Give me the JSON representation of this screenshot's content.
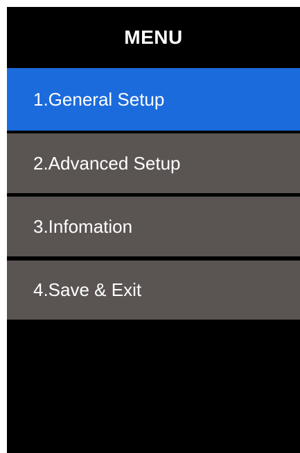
{
  "menu": {
    "title": "MENU",
    "selected_color": "#1b6bdc",
    "item_color": "#5a5453",
    "items": [
      {
        "label": "1.General Setup",
        "selected": true
      },
      {
        "label": "2.Advanced Setup",
        "selected": false
      },
      {
        "label": "3.Infomation",
        "selected": false
      },
      {
        "label": "4.Save & Exit",
        "selected": false
      }
    ]
  }
}
